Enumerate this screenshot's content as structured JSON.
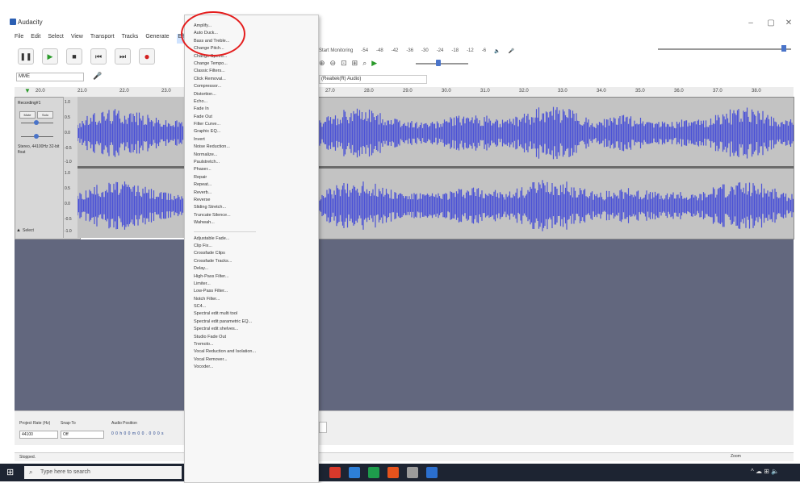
{
  "window": {
    "title": "Audacity",
    "controls": {
      "minimize": "–",
      "maximize": "▢",
      "close": "✕"
    }
  },
  "menubar": [
    "File",
    "Edit",
    "Select",
    "View",
    "Transport",
    "Tracks",
    "Generate",
    "Effect"
  ],
  "transport": {
    "pause": "❚❚",
    "play": "▶",
    "stop": "■",
    "skip_start": "⏮",
    "skip_end": "⏭",
    "record": "●"
  },
  "host_select": {
    "value": "MME"
  },
  "meter": {
    "label": "Start Monitoring",
    "ticks": [
      "-54",
      "-48",
      "-42",
      "-36",
      "-30",
      "-24",
      "-18",
      "-12",
      "-6"
    ]
  },
  "device_select": {
    "value": "(Realtek(R) Audio)"
  },
  "ruler": {
    "left_ticks": [
      "20.0",
      "21.0",
      "22.0",
      "23.0"
    ],
    "right_ticks": [
      "27.0",
      "28.0",
      "29.0",
      "30.0",
      "31.0",
      "32.0",
      "33.0",
      "34.0",
      "35.0",
      "36.0",
      "37.0",
      "38.0"
    ]
  },
  "track": {
    "name": "Recording#1",
    "mute": "Mute",
    "solo": "Solo",
    "info": "Stereo, 44100Hz 32-bit float",
    "select": "Select",
    "scale_top": [
      "1.0",
      "0.5",
      "0.0",
      "-0.5",
      "-1.0"
    ],
    "scale_bottom": [
      "1.0",
      "0.5",
      "0.0",
      "-0.5",
      "-1.0"
    ]
  },
  "selection_toolbar": {
    "rate_label": "Project Rate (Hz)",
    "rate_value": "44100",
    "snap_label": "Snap-To",
    "snap_value": "Off",
    "audio_position_label": "Audio Position",
    "audio_position_value": "0 0 h 0 0 m 0 0 . 0 0 0 s"
  },
  "project_tab": "Stopped.",
  "status": {
    "left": "Stopped.",
    "zoom": "Zoom"
  },
  "taskbar": {
    "search_placeholder": "Type here to search",
    "icon_colors": [
      "#d8392b",
      "#2d7fd8",
      "#1e9c4c",
      "#e6531c",
      "#9b9b9b",
      "#2b6fce"
    ]
  },
  "effect_menu": {
    "items_group1": [
      "Amplify...",
      "Auto Duck...",
      "Bass and Treble...",
      "Change Pitch...",
      "Change Speed...",
      "Change Tempo...",
      "Classic Filters...",
      "Click Removal...",
      "Compressor...",
      "Distortion...",
      "Echo...",
      "Fade In",
      "Fade Out",
      "Filter Curve...",
      "Graphic EQ...",
      "Invert",
      "Noise Reduction...",
      "Normalize...",
      "Paulstretch...",
      "Phaser...",
      "Repair",
      "Repeat...",
      "Reverb...",
      "Reverse",
      "Sliding Stretch...",
      "Truncate Silence...",
      "Wahwah..."
    ],
    "items_group2": [
      "Adjustable Fade...",
      "Clip Fix...",
      "Crossfade Clips",
      "Crossfade Tracks...",
      "Delay...",
      "High-Pass Filter...",
      "Limiter...",
      "Low-Pass Filter...",
      "Notch Filter...",
      "SC4...",
      "Spectral edit multi tool",
      "Spectral edit parametric EQ...",
      "Spectral edit shelves...",
      "Studio Fade Out",
      "Tremolo...",
      "Vocal Reduction and Isolation...",
      "Vocal Remover...",
      "Vocoder..."
    ]
  },
  "colors": {
    "waveform": "#4b52d6",
    "waveform_bg": "#c3c3c3",
    "empty_area": "#62677e",
    "highlight": "#e41e1e"
  }
}
